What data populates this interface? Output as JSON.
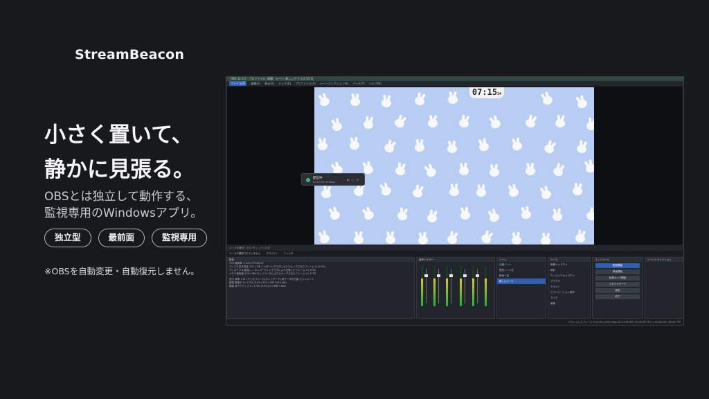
{
  "brand": "StreamBeacon",
  "headline": {
    "line1": "小さく置いて、",
    "line2": "静かに見張る。"
  },
  "subtitle": {
    "line1": "OBSとは独立して動作する、",
    "line2": "監視専用のWindowsアプリ。"
  },
  "tags": [
    "独立型",
    "最前面",
    "監視専用"
  ],
  "note": "※OBSを自動変更・自動復元しません。",
  "obs": {
    "titlebar": "OBS 32.0.1 - プロファイル: 無題 - シーン: 新しいアプリ(1:10:1)",
    "menu": [
      "ファイル(F)",
      "編集(E)",
      "表示(V)",
      "ドック(D)",
      "プロファイル(P)",
      "シーンコレクション(S)",
      "ツール(T)",
      "ヘルプ(H)"
    ],
    "clock": {
      "main": "07:15",
      "sub": "34"
    },
    "widget": {
      "status": "配信中",
      "detail": "00:12:06 / 6 Mbps"
    },
    "tabstrip": "ソース未選択  |  プロパティ  |  フィルタ",
    "ctrlrow": [
      "ソースが選択されていません",
      "プロパティ",
      "フィルタ"
    ],
    "docks": {
      "stats": "統計",
      "mixer": "音声ミキサー",
      "scenes": "シーン",
      "sources": "ソース",
      "controls": "コントロール",
      "transitions": "シーントランジション"
    },
    "stats_rows": [
      "CPU 使用率   1.10%        FPS   60.00",
      "ディスク空き容量   125.1 GB   レンダリングラグによりスキップされたフレーム   0 (0.0%)",
      "ディスクフル(推定)   ---   エンコーディングラグにより欠落したフレーム   0 / 1720",
      "メモリ使用量   240.3 MB   ネットワークによりスキップされたフレーム   0 / 1720",
      "出力   状態   ドロップしたフレーム(ネットワーク)   総データ出力量   ビットレート",
      "配信   配信中   0 / 1720 (0.0%)   303.1 MB   5423 kb/s",
      "録画   非アクティブ   0 / 1720 (0.0%)   0.0 MB   0 kb/s"
    ],
    "scenes": [
      "元素シーン",
      "配信シーン名",
      "録画一覧",
      "新しいシーン"
    ],
    "sources": [
      "映像キャプチャ",
      "時計",
      "ウィンドウキャプチャ",
      "ブラウザ",
      "テキスト",
      "アプリケーション音声",
      "マイク",
      "画像"
    ],
    "controls": [
      "配信開始",
      "録画開始",
      "仮想カメラ開始",
      "スタジオモード",
      "設定",
      "終了"
    ],
    "statusbar": "ドロップしたフレーム 0 (0.0%)   5423 kbps   00:12:06   REC 00:00:00   CPU 1.1%  60.00 / 60.00 FPS"
  }
}
